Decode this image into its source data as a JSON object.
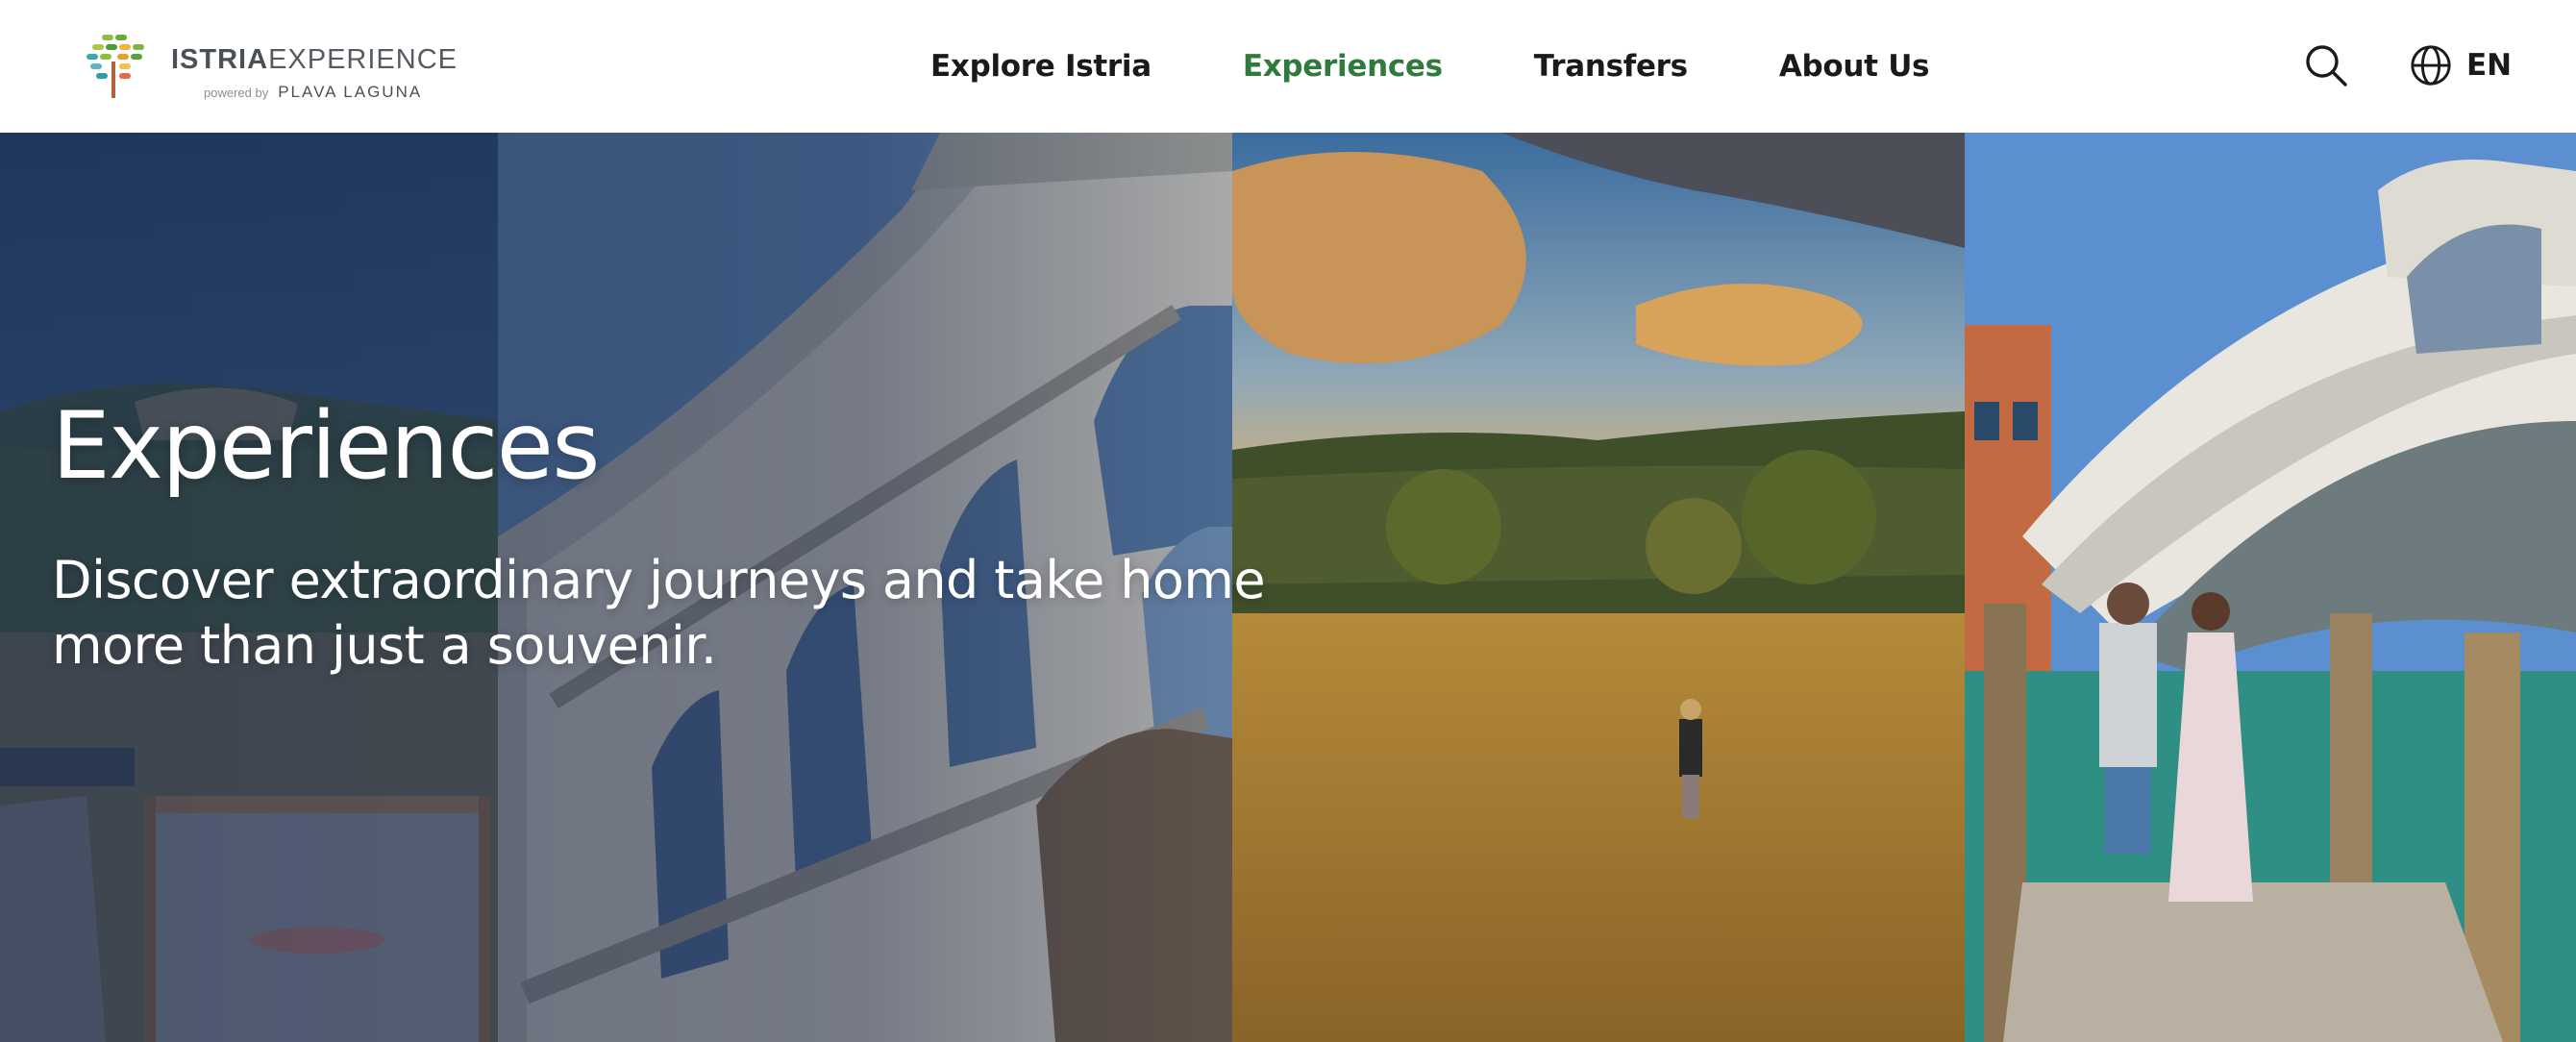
{
  "header": {
    "logo": {
      "brand_bold": "ISTRIA",
      "brand_light": "EXPERIENCE",
      "powered_by": "powered by",
      "partner": "PLAVA LAGUNA"
    },
    "nav": [
      {
        "label": "Explore Istria",
        "active": false
      },
      {
        "label": "Experiences",
        "active": true
      },
      {
        "label": "Transfers",
        "active": false
      },
      {
        "label": "About Us",
        "active": false
      }
    ],
    "search_icon": "search-icon",
    "language": {
      "icon": "globe-icon",
      "label": "EN"
    }
  },
  "hero": {
    "title": "Experiences",
    "subtitle": "Discover extraordinary journeys and take home more than just a souvenir."
  },
  "colors": {
    "nav_active": "#2f7a3c",
    "nav_text": "#1a1a1a",
    "hero_text": "#ffffff",
    "overlay": "#182646"
  }
}
